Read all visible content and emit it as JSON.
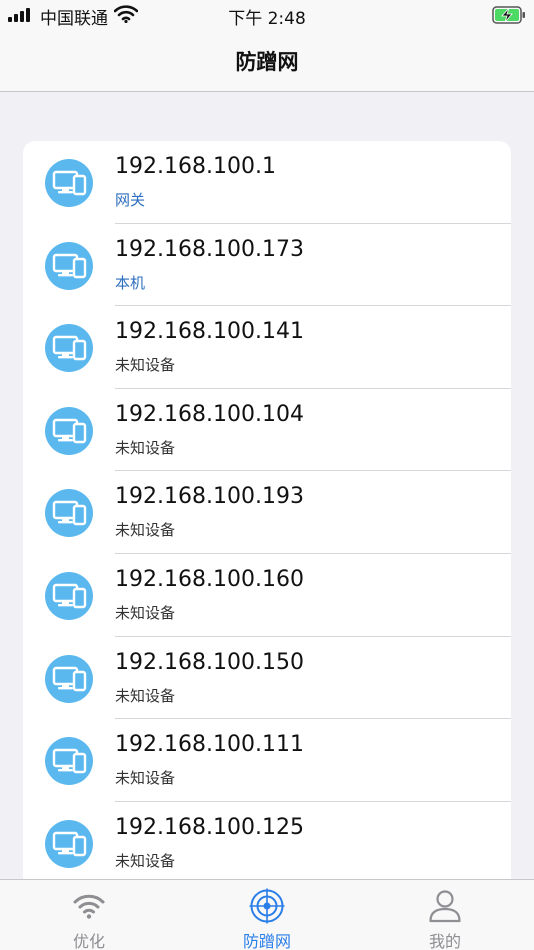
{
  "status_bar": {
    "carrier": "中国联通",
    "time": "下午 2:48",
    "icons": [
      "signal-icon",
      "wifi-icon",
      "battery-charging-icon"
    ]
  },
  "nav": {
    "title": "防蹭网"
  },
  "devices": [
    {
      "ip": "192.168.100.1",
      "label": "网关",
      "highlight": true
    },
    {
      "ip": "192.168.100.173",
      "label": "本机",
      "highlight": true
    },
    {
      "ip": "192.168.100.141",
      "label": "未知设备",
      "highlight": false
    },
    {
      "ip": "192.168.100.104",
      "label": "未知设备",
      "highlight": false
    },
    {
      "ip": "192.168.100.193",
      "label": "未知设备",
      "highlight": false
    },
    {
      "ip": "192.168.100.160",
      "label": "未知设备",
      "highlight": false
    },
    {
      "ip": "192.168.100.150",
      "label": "未知设备",
      "highlight": false
    },
    {
      "ip": "192.168.100.111",
      "label": "未知设备",
      "highlight": false
    },
    {
      "ip": "192.168.100.125",
      "label": "未知设备",
      "highlight": false
    }
  ],
  "tabs": [
    {
      "label": "优化",
      "icon": "wifi-icon",
      "active": false
    },
    {
      "label": "防蹭网",
      "icon": "radar-target-icon",
      "active": true
    },
    {
      "label": "我的",
      "icon": "person-icon",
      "active": false
    }
  ],
  "colors": {
    "accent": "#2a7ee8",
    "device_icon_bg": "#5bb8ef",
    "highlight_text": "#2e6fbf",
    "inactive_tab": "#8e8e93"
  }
}
